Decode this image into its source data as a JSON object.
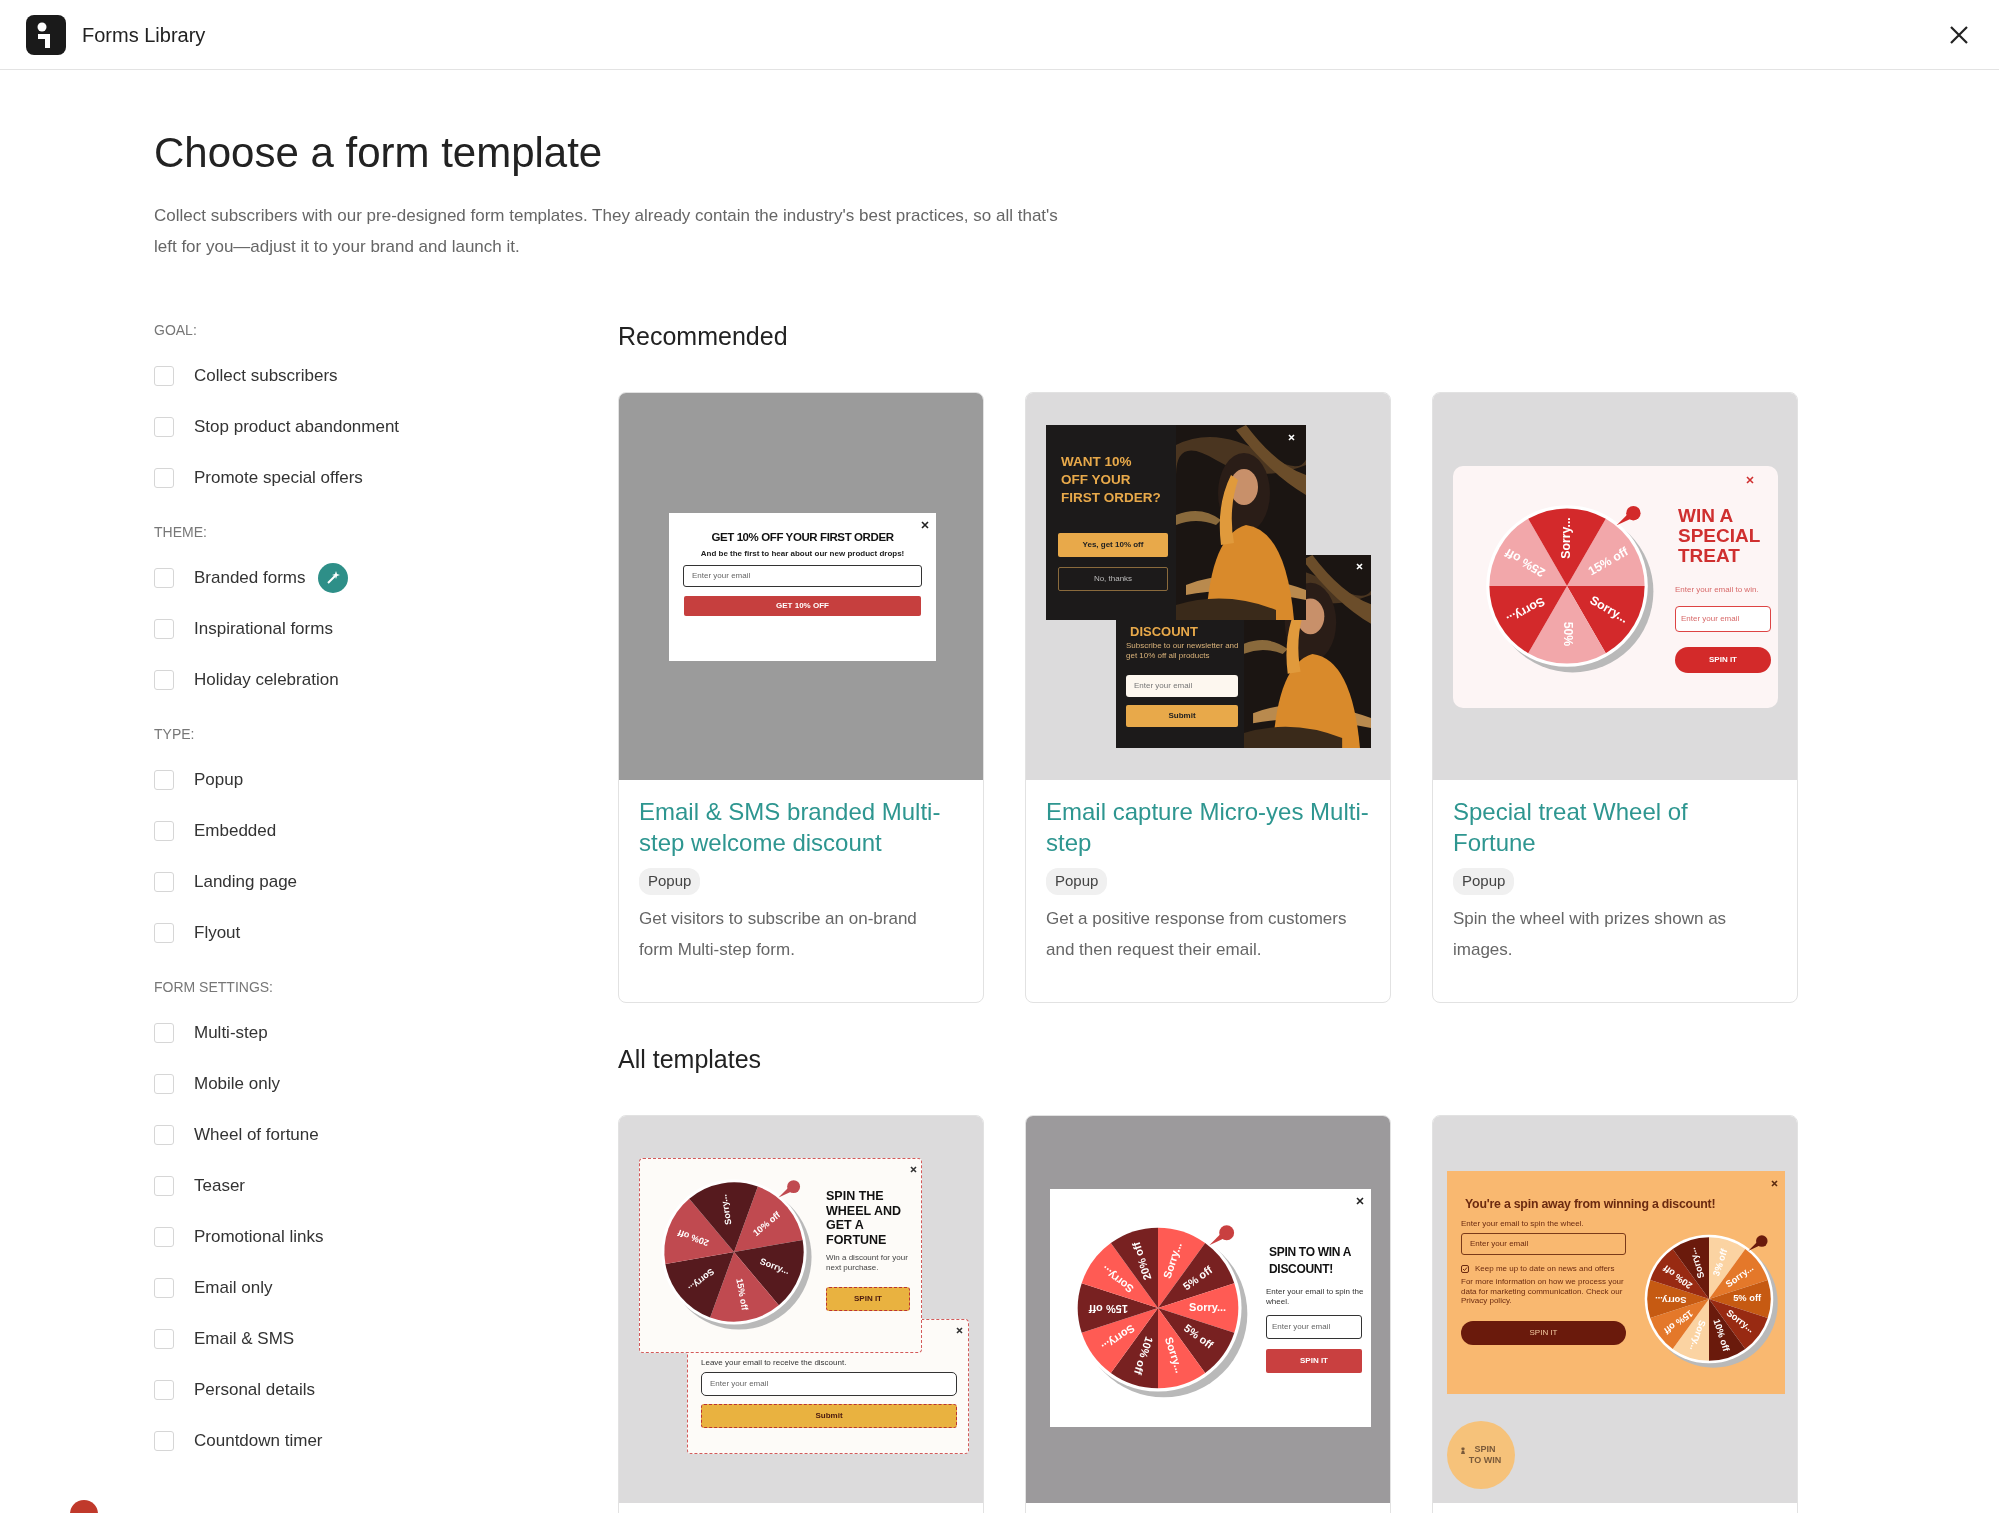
{
  "header": {
    "title": "Forms Library"
  },
  "heading": "Choose a form template",
  "intro": "Collect subscribers with our pre-designed form templates. They already contain the industry's best practices, so all that's left for you—adjust it to your brand and launch it.",
  "filters": [
    {
      "heading": "GOAL:",
      "options": [
        {
          "label": "Collect subscribers",
          "checked": false,
          "kind": "plain"
        },
        {
          "label": "Stop product abandonment",
          "checked": false,
          "kind": "plain"
        },
        {
          "label": "Promote special offers",
          "checked": false,
          "kind": "plain"
        }
      ]
    },
    {
      "heading": "THEME:",
      "options": [
        {
          "label": "Branded forms",
          "checked": false,
          "kind": "featured"
        },
        {
          "label": "Inspirational forms",
          "checked": false,
          "kind": "plain"
        },
        {
          "label": "Holiday celebration",
          "checked": false,
          "kind": "plain"
        }
      ]
    },
    {
      "heading": "TYPE:",
      "options": [
        {
          "label": "Popup",
          "checked": false,
          "kind": "plain"
        },
        {
          "label": "Embedded",
          "checked": false,
          "kind": "plain"
        },
        {
          "label": "Landing page",
          "checked": false,
          "kind": "plain"
        },
        {
          "label": "Flyout",
          "checked": false,
          "kind": "plain"
        }
      ]
    },
    {
      "heading": "FORM SETTINGS:",
      "options": [
        {
          "label": "Multi-step",
          "checked": false,
          "kind": "plain"
        },
        {
          "label": "Mobile only",
          "checked": false,
          "kind": "plain"
        },
        {
          "label": "Wheel of fortune",
          "checked": false,
          "kind": "plain"
        },
        {
          "label": "Teaser",
          "checked": false,
          "kind": "plain"
        },
        {
          "label": "Promotional links",
          "checked": false,
          "kind": "plain"
        },
        {
          "label": "Email only",
          "checked": false,
          "kind": "plain"
        },
        {
          "label": "Email & SMS",
          "checked": false,
          "kind": "plain"
        },
        {
          "label": "Personal details",
          "checked": false,
          "kind": "plain"
        },
        {
          "label": "Countdown timer",
          "checked": false,
          "kind": "plain"
        }
      ]
    }
  ],
  "sections": [
    {
      "title": "Recommended",
      "templates": [
        {
          "title": "Email & SMS branded Multi-step welcome discount",
          "tag": "Popup",
          "description": "Get visitors to subscribe an on-brand form Multi-step form.",
          "preview": {
            "kind": "simple",
            "heading": "GET 10% OFF YOUR FIRST ORDER",
            "text": "And be the first to hear about our new product drops!",
            "placeholder": "Enter your email",
            "button": "GET 10% OFF"
          }
        },
        {
          "title": "Email capture Micro-yes Multi-step",
          "tag": "Popup",
          "description": "Get a positive response from customers and then request their email.",
          "preview": {
            "kind": "photo-steps",
            "step_1": {
              "heading": "WANT 10% OFF YOUR FIRST ORDER?",
              "buttons": [
                "Yes, get 10% off",
                "No, thanks"
              ]
            },
            "step_2": {
              "heading": "DISCOUNT",
              "text": "Subscribe to our newsletter and get 10% off all products",
              "placeholder": "Enter your email",
              "button": "Submit"
            }
          }
        },
        {
          "title": "Special treat Wheel of Fortune",
          "tag": "Popup",
          "description": "Spin the wheel with prizes shown as images.",
          "preview": {
            "kind": "wheel-rounded",
            "heading": "WIN A SPECIAL TREAT",
            "text": "Enter your email to win.",
            "placeholder": "Enter your email",
            "button": "SPIN IT",
            "wheel": [
              {
                "label": "15% off",
                "color": "#f2a7aa"
              },
              {
                "label": "Sorry...",
                "color": "#d3292b"
              },
              {
                "label": "50%",
                "color": "#f2a7aa"
              },
              {
                "label": "Sorry...",
                "color": "#d3292b"
              },
              {
                "label": "25% off",
                "color": "#f2a7aa"
              },
              {
                "label": "Sorry...",
                "color": "#d3292b"
              }
            ]
          }
        }
      ]
    },
    {
      "title": "All templates",
      "templates": [
        {
          "preview": {
            "kind": "wheel-steps",
            "heading": "SPIN THE WHEEL AND GET A FORTUNE",
            "text": "Win a discount for your next purchase.",
            "button": "SPIN IT",
            "wheel": [
              {
                "label": "10% off",
                "color": "#c04a50"
              },
              {
                "label": "Sorry...",
                "color": "#561a1e"
              },
              {
                "label": "15% off",
                "color": "#c04a50"
              },
              {
                "label": "Sorry...",
                "color": "#561a1e"
              },
              {
                "label": "20% off",
                "color": "#c04a50"
              },
              {
                "label": "Sorry...",
                "color": "#561a1e"
              }
            ],
            "step_2": {
              "text": "Leave your email to receive the discount.",
              "placeholder": "Enter your email",
              "button": "Submit"
            }
          }
        },
        {
          "preview": {
            "kind": "wheel-framed",
            "heading": "SPIN TO WIN A DISCOUNT!",
            "text": "Enter your email to spin the wheel.",
            "placeholder": "Enter your email",
            "button": "SPIN IT",
            "wheel": [
              {
                "label": "Sorry...",
                "color": "#ff5b54"
              },
              {
                "label": "5% off",
                "color": "#782121"
              },
              {
                "label": "Sorry...",
                "color": "#ff5b54"
              },
              {
                "label": "5% off",
                "color": "#782121"
              },
              {
                "label": "Sorry...",
                "color": "#ff5b54"
              },
              {
                "label": "10% off",
                "color": "#782121"
              },
              {
                "label": "Sorry...",
                "color": "#ff5b54"
              },
              {
                "label": "15% off",
                "color": "#782121"
              },
              {
                "label": "Sorry...",
                "color": "#ff5b54"
              },
              {
                "label": "20% off",
                "color": "#782121"
              }
            ]
          }
        },
        {
          "preview": {
            "kind": "wheel-banner",
            "heading": "You're a spin away from winning a discount!",
            "text": "Enter your email to spin the wheel.",
            "placeholder": "Enter your email",
            "consent": {
              "label": "Keep me up to date on news and offers",
              "checked": true
            },
            "note": "For more information on how we process your data for marketing communication. Check our Privacy policy.",
            "button": "SPIN IT",
            "teaser": "SPIN TO WIN",
            "wheel": [
              {
                "label": "3% off",
                "color": "#fbd3a2"
              },
              {
                "label": "Sorry...",
                "color": "#e4782a"
              },
              {
                "label": "5% off",
                "color": "#c65a12"
              },
              {
                "label": "Sorry...",
                "color": "#982a12"
              },
              {
                "label": "10% off",
                "color": "#6a1a0c"
              },
              {
                "label": "Sorry...",
                "color": "#fbd3a2"
              },
              {
                "label": "15% off",
                "color": "#e4782a"
              },
              {
                "label": "Sorry...",
                "color": "#c65a12"
              },
              {
                "label": "20% off",
                "color": "#982a12"
              },
              {
                "label": "Sorry...",
                "color": "#6a1a0c"
              }
            ]
          }
        }
      ]
    }
  ]
}
